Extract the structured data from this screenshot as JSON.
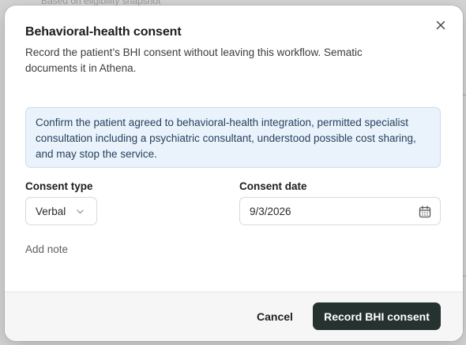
{
  "background": {
    "peek_text": "Based on eligibility snapshot"
  },
  "dialog": {
    "title": "Behavioral-health consent",
    "description": "Record the patient’s BHI consent without leaving this workflow. Sematic documents it in Athena.",
    "close_icon": "close-icon",
    "info": "Confirm the patient agreed to behavioral-health integration, permitted specialist consultation including a psychiatric consultant, understood possible cost sharing, and may stop the service.",
    "consent_type": {
      "label": "Consent type",
      "value": "Verbal",
      "icon": "chevron-down-icon"
    },
    "consent_date": {
      "label": "Consent date",
      "value": "9/3/2026",
      "icon": "calendar-icon"
    },
    "add_note_label": "Add note",
    "footer": {
      "cancel_label": "Cancel",
      "submit_label": "Record BHI consent"
    }
  },
  "colors": {
    "primary_button": "#263230",
    "info_background": "#eaf3fc",
    "info_border": "#c9dcef",
    "info_text": "#26415e"
  }
}
